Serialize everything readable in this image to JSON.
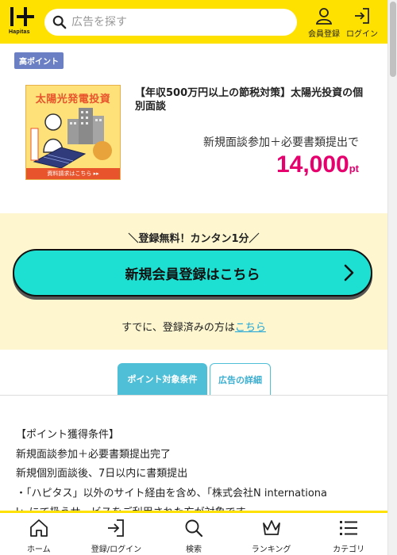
{
  "header": {
    "logo_text": "Hapitas",
    "search_placeholder": "広告を探す",
    "member_register_label": "会員登録",
    "login_label": "ログイン"
  },
  "offer": {
    "badge": "高ポイント",
    "banner": {
      "title": "太陽光発電投資",
      "side_text": "無料で資料請求",
      "bottom_text": "資料請求はこちら ▸▸"
    },
    "title": "【年収500万円以上の節税対策】太陽光投資の個別面談",
    "condition": "新規面談参加＋必要書類提出で",
    "points_value": "14,000",
    "points_unit": "pt"
  },
  "register": {
    "catch": "＼登録無料！カンタン1分／",
    "cta_label": "新規会員登録はこちら",
    "already_text": "すでに、登録済みの方は",
    "already_link": "こちら"
  },
  "tabs": [
    {
      "label": "ポイント対象条件",
      "active": true
    },
    {
      "label": "広告の詳細",
      "active": false
    }
  ],
  "details": {
    "lines": [
      "【ポイント獲得条件】",
      "新規面談参加＋必要書類提出完了",
      "新規個別面談後、7日以内に書類提出",
      "・「ハピタス」以外のサイト経由を含め、「株式会社N internationa",
      "l」にて扱うサービスをご利用された方が対象です。"
    ]
  },
  "bottom_nav": [
    {
      "label": "ホーム",
      "icon": "home-icon"
    },
    {
      "label": "登録/ログイン",
      "icon": "login-icon"
    },
    {
      "label": "検索",
      "icon": "search-icon"
    },
    {
      "label": "ランキング",
      "icon": "crown-icon"
    },
    {
      "label": "カテゴリ",
      "icon": "list-icon"
    }
  ],
  "colors": {
    "brand_yellow": "#ffe100",
    "cta_cyan": "#1ee0d2",
    "points_pink": "#e6006e",
    "tab_blue": "#4fbfd8",
    "badge_blue": "#6b7fc4"
  }
}
